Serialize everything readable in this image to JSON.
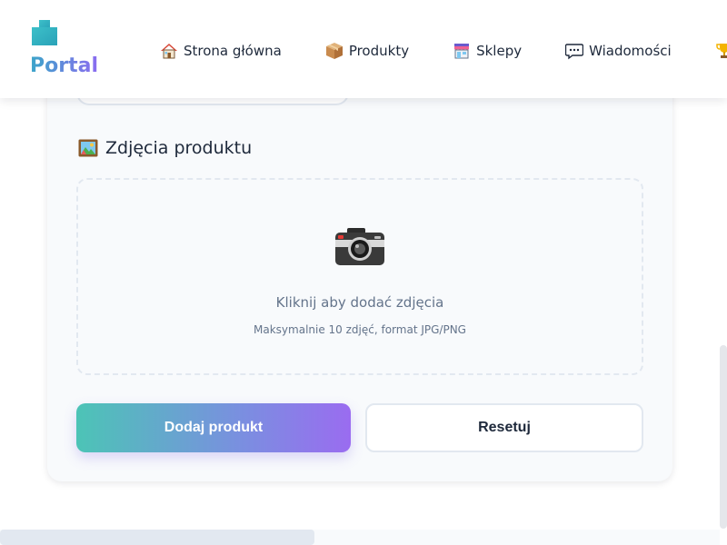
{
  "header": {
    "logo_text": "Portal",
    "nav": [
      {
        "label": "Strona główna",
        "icon": "house-icon"
      },
      {
        "label": "Produkty",
        "icon": "package-icon"
      },
      {
        "label": "Sklepy",
        "icon": "store-icon"
      },
      {
        "label": "Wiadomości",
        "icon": "speech-bubble-icon"
      },
      {
        "label": "",
        "icon": "trophy-icon"
      }
    ]
  },
  "form": {
    "photos_section_title": "Zdjęcia produktu",
    "photos_section_icon": "framed-picture-icon",
    "dropzone": {
      "icon": "camera-icon",
      "primary_text": "Kliknij aby dodać zdjęcia",
      "secondary_text": "Maksymalnie 10 zdjęć, format JPG/PNG"
    },
    "submit_label": "Dodaj produkt",
    "reset_label": "Resetuj"
  },
  "colors": {
    "accent_gradient_start": "#4cc4b6",
    "accent_gradient_end": "#9a6cf0",
    "text_primary": "#1e293b",
    "text_muted": "#64748b",
    "border": "#e2e8f0"
  }
}
